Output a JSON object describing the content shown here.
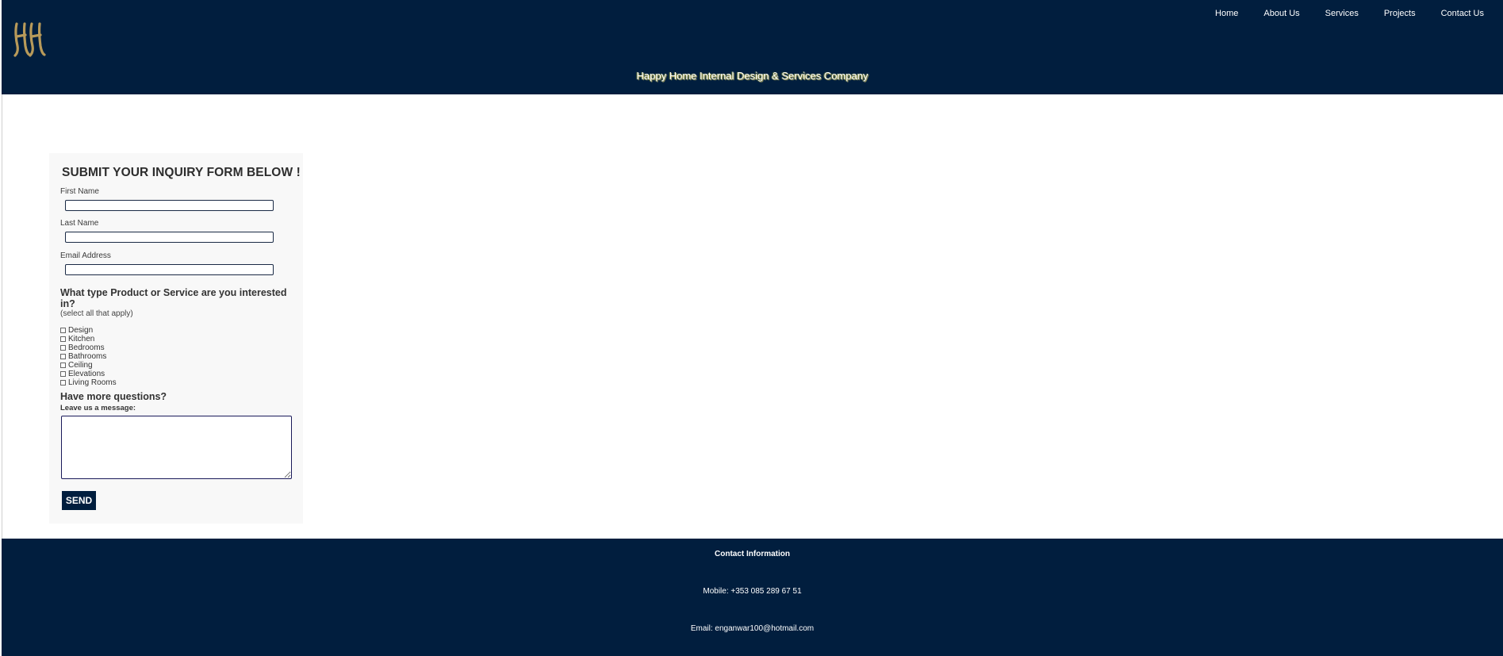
{
  "header": {
    "logo_alt": "HH",
    "nav": [
      "Home",
      "About Us",
      "Services",
      "Projects",
      "Contact Us"
    ],
    "tagline": "Happy Home Internal Design & Services Company",
    "colors": {
      "brand_navy": "#011e3e",
      "logo_gold": "#b89a5a"
    }
  },
  "form": {
    "title": "SUBMIT YOUR INQUIRY FORM BELOW !",
    "first_name_label": "First Name",
    "first_name_value": "",
    "last_name_label": "Last Name",
    "last_name_value": "",
    "email_label": "Email Address",
    "email_value": "",
    "question": "What type Product or Service are you interested in?",
    "hint": "(select all that apply)",
    "options": [
      "Design",
      "Kitchen",
      "Bedrooms",
      "Bathrooms",
      "Ceiling",
      "Elevations",
      "Living Rooms"
    ],
    "more_questions": "Have more questions?",
    "message_label": "Leave us a message:",
    "message_value": "",
    "send_label": "SEND"
  },
  "footer": {
    "title": "Contact Information",
    "mobile": "Mobile: +353 085 289 67 51",
    "email": "Email: enganwar100@hotmail.com"
  }
}
